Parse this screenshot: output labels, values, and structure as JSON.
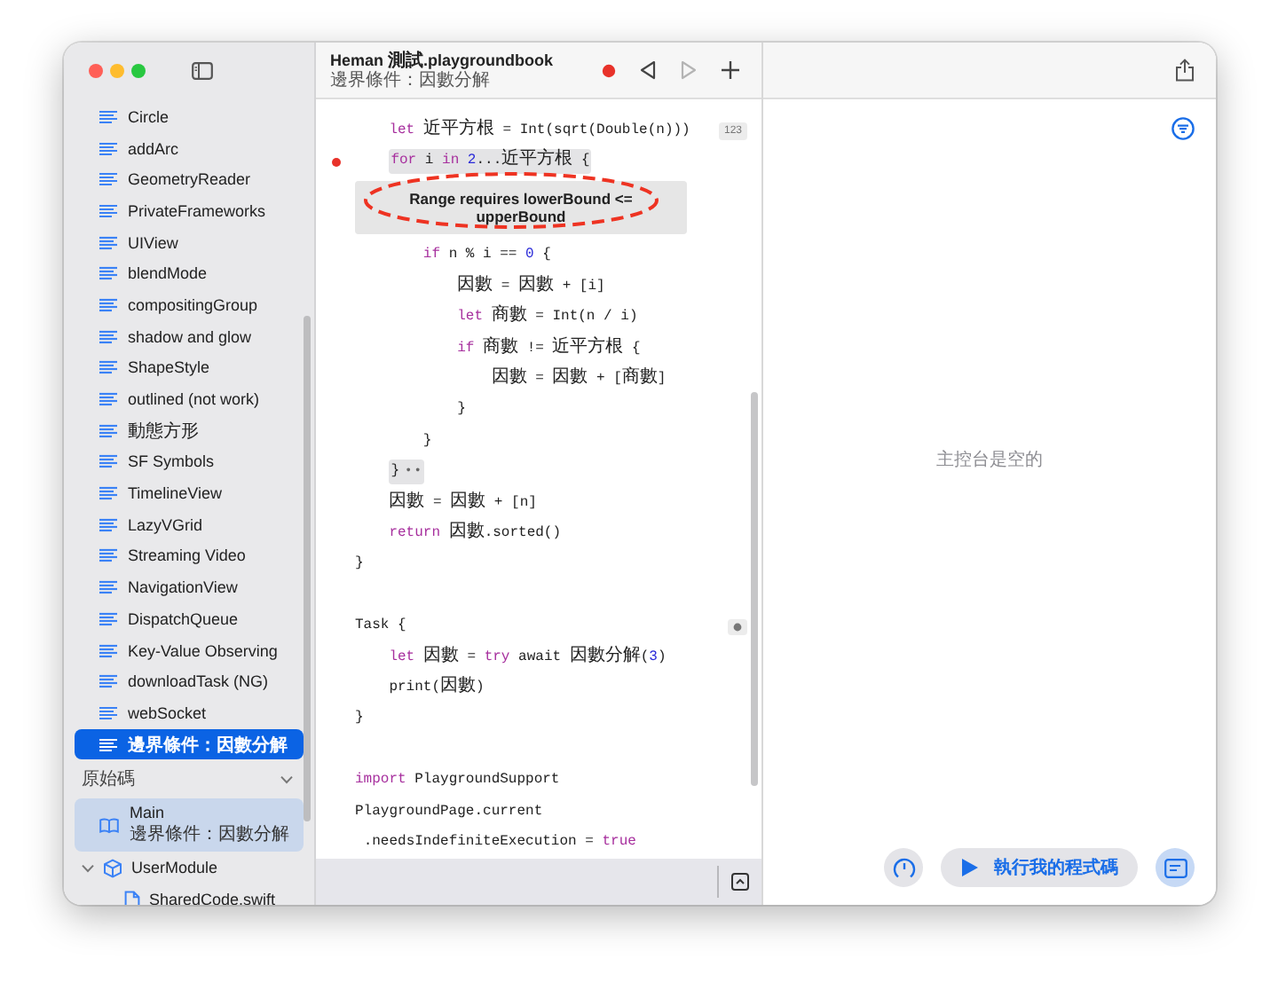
{
  "window": {
    "title": "Heman 測試.playgroundbook",
    "subtitle": "邊界條件：因數分解"
  },
  "toolbar": {
    "buttons": [
      {
        "kind": "record",
        "disabled": false
      },
      {
        "kind": "back",
        "disabled": false
      },
      {
        "kind": "forward",
        "disabled": true
      },
      {
        "kind": "add",
        "disabled": false
      }
    ]
  },
  "sidebar": {
    "pages": [
      {
        "label": "Circle",
        "selected": false
      },
      {
        "label": "addArc",
        "selected": false
      },
      {
        "label": "GeometryReader",
        "selected": false
      },
      {
        "label": "PrivateFrameworks",
        "selected": false
      },
      {
        "label": "UIView",
        "selected": false
      },
      {
        "label": "blendMode",
        "selected": false
      },
      {
        "label": "compositingGroup",
        "selected": false
      },
      {
        "label": "shadow and glow",
        "selected": false
      },
      {
        "label": "ShapeStyle",
        "selected": false
      },
      {
        "label": "outlined (not work)",
        "selected": false
      },
      {
        "label": "動態方形",
        "selected": false
      },
      {
        "label": "SF Symbols",
        "selected": false
      },
      {
        "label": "TimelineView",
        "selected": false
      },
      {
        "label": "LazyVGrid",
        "selected": false
      },
      {
        "label": "Streaming Video",
        "selected": false
      },
      {
        "label": "NavigationView",
        "selected": false
      },
      {
        "label": "DispatchQueue",
        "selected": false
      },
      {
        "label": "Key-Value Observing",
        "selected": false
      },
      {
        "label": "downloadTask (NG)",
        "selected": false
      },
      {
        "label": "webSocket",
        "selected": false
      },
      {
        "label": "邊界條件：因數分解",
        "selected": true
      }
    ],
    "sources_header": "原始碼",
    "sources_expanded": true,
    "sources": [
      {
        "kind": "page",
        "label": "Main",
        "subtitle": "邊界條件：因數分解",
        "selected": true
      },
      {
        "kind": "module",
        "label": "UserModule",
        "selected": false,
        "expanded": true,
        "children": [
          {
            "kind": "file",
            "label": "SharedCode.swift",
            "selected": false
          }
        ]
      }
    ]
  },
  "editor": {
    "lines": [
      {
        "kind": "code",
        "tokens": [
          {
            "kind": "keyword",
            "text": "    let"
          },
          {
            "kind": "plain",
            "text": " 近平方根 = Int(sqrt(Double(n)))"
          }
        ],
        "result": {
          "kind": "text",
          "text": "123"
        }
      },
      {
        "kind": "code",
        "breakpoint": true,
        "highlighted": true,
        "tokens": [
          {
            "kind": "keyword",
            "text": "    for"
          },
          {
            "kind": "plain",
            "text": " i "
          },
          {
            "kind": "keyword",
            "text": "in"
          },
          {
            "kind": "number",
            "text": " 2"
          },
          {
            "kind": "plain",
            "text": "...近平方根 {"
          }
        ],
        "error": "Range requires lowerBound <= upperBound"
      },
      {
        "kind": "code",
        "tokens": [
          {
            "kind": "keyword",
            "text": "        if"
          },
          {
            "kind": "plain",
            "text": " n % i == "
          },
          {
            "kind": "number",
            "text": "0"
          },
          {
            "kind": "plain",
            "text": " {"
          }
        ]
      },
      {
        "kind": "code",
        "tokens": [
          {
            "kind": "plain",
            "text": "            因數 = 因數 + [i]"
          }
        ]
      },
      {
        "kind": "code",
        "tokens": [
          {
            "kind": "keyword",
            "text": "            let"
          },
          {
            "kind": "plain",
            "text": " 商數 = Int(n / i)"
          }
        ]
      },
      {
        "kind": "code",
        "tokens": [
          {
            "kind": "keyword",
            "text": "            if"
          },
          {
            "kind": "plain",
            "text": " 商數 != 近平方根 {"
          }
        ]
      },
      {
        "kind": "code",
        "tokens": [
          {
            "kind": "plain",
            "text": "                因數 = 因數 + [商數]"
          }
        ]
      },
      {
        "kind": "code",
        "tokens": [
          {
            "kind": "plain",
            "text": "            }"
          }
        ]
      },
      {
        "kind": "code",
        "tokens": [
          {
            "kind": "plain",
            "text": "        }"
          }
        ]
      },
      {
        "kind": "code",
        "highlighted": true,
        "tokens": [
          {
            "kind": "plain",
            "text": "    }"
          },
          {
            "kind": "fold",
            "text": "••"
          }
        ]
      },
      {
        "kind": "code",
        "tokens": [
          {
            "kind": "plain",
            "text": "    因數 = 因數 + [n]"
          }
        ]
      },
      {
        "kind": "code",
        "tokens": [
          {
            "kind": "keyword",
            "text": "    return"
          },
          {
            "kind": "plain",
            "text": " 因數.sorted()"
          }
        ]
      },
      {
        "kind": "code",
        "tokens": [
          {
            "kind": "plain",
            "text": "}"
          }
        ]
      },
      {
        "kind": "blank"
      },
      {
        "kind": "code",
        "tokens": [
          {
            "kind": "plain",
            "text": "Task {"
          }
        ],
        "result": {
          "kind": "icon"
        }
      },
      {
        "kind": "code",
        "tokens": [
          {
            "kind": "keyword",
            "text": "    let"
          },
          {
            "kind": "plain",
            "text": " 因數 = "
          },
          {
            "kind": "keyword",
            "text": "try"
          },
          {
            "kind": "plain",
            "text": " await 因數分解("
          },
          {
            "kind": "number",
            "text": "3"
          },
          {
            "kind": "plain",
            "text": ")"
          }
        ]
      },
      {
        "kind": "code",
        "tokens": [
          {
            "kind": "plain",
            "text": "    print(因數)"
          }
        ]
      },
      {
        "kind": "code",
        "tokens": [
          {
            "kind": "plain",
            "text": "}"
          }
        ]
      },
      {
        "kind": "blank"
      },
      {
        "kind": "code",
        "tokens": [
          {
            "kind": "keyword",
            "text": "import"
          },
          {
            "kind": "plain",
            "text": " PlaygroundSupport"
          }
        ]
      },
      {
        "kind": "code",
        "tokens": [
          {
            "kind": "plain",
            "text": "PlaygroundPage.current"
          }
        ]
      },
      {
        "kind": "code",
        "tokens": [
          {
            "kind": "plain",
            "text": " .needsIndefiniteExecution = "
          },
          {
            "kind": "keyword",
            "text": "true"
          }
        ]
      }
    ]
  },
  "console": {
    "message": "主控台是空的",
    "run_label": "執行我的程式碼",
    "console_on": true
  }
}
